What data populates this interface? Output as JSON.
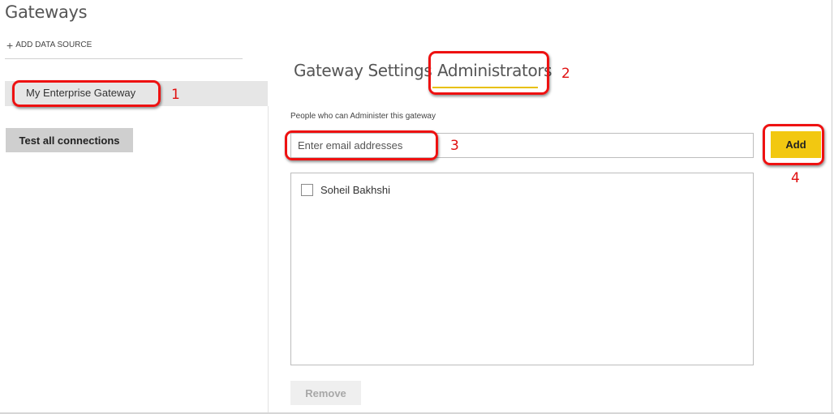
{
  "page": {
    "title": "Gateways"
  },
  "sidebar": {
    "add_data_source": "ADD DATA SOURCE",
    "gateways": [
      {
        "label": "My Enterprise Gateway",
        "selected": true
      }
    ],
    "test_all_label": "Test all connections"
  },
  "tabs": [
    {
      "label": "Gateway Settings",
      "active": false
    },
    {
      "label": "Administrators",
      "active": true
    }
  ],
  "admins_panel": {
    "field_label": "People who can Administer this gateway",
    "email_placeholder": "Enter email addresses",
    "add_label": "Add",
    "admins": [
      {
        "name": "Soheil Bakhshi",
        "checked": false
      }
    ],
    "remove_label": "Remove"
  },
  "annotations": {
    "color": "#ee1111",
    "step1": "1",
    "step2": "2",
    "step3": "3",
    "step4": "4"
  },
  "colors": {
    "accent": "#f2c811",
    "selected_bg": "#e6e6e6",
    "button_gray": "#cfcfcf"
  },
  "icons": {
    "add_data_source": "plus-icon"
  }
}
